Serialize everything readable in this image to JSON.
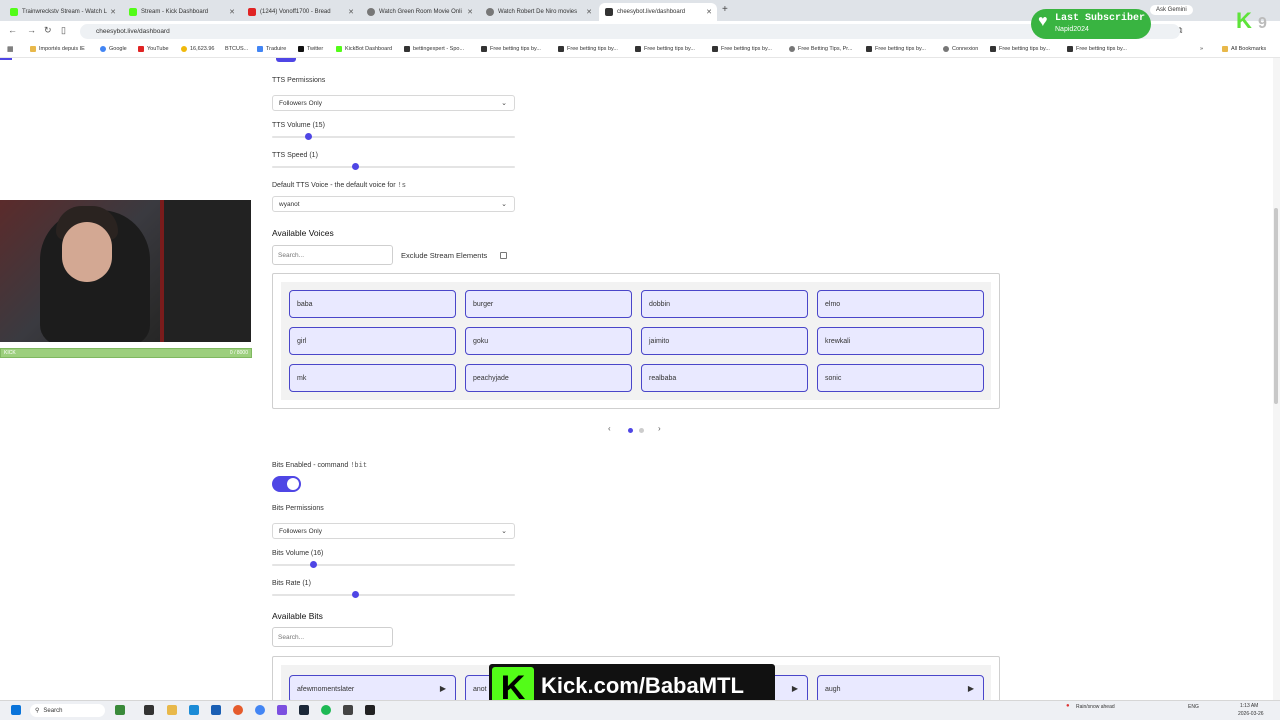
{
  "browser": {
    "tabs": [
      {
        "title": "Trainwreckstv Stream - Watch L"
      },
      {
        "title": "Stream - Kick Dashboard"
      },
      {
        "title": "(1244) Vonoff1700 - Bread"
      },
      {
        "title": "Watch Green Room Movie Onli"
      },
      {
        "title": "Watch Robert De Niro movies"
      },
      {
        "title": "cheesybot.live/dashboard"
      }
    ],
    "url": "cheesybot.live/dashboard",
    "ask_gemini": "Ask Gemini",
    "bookmarks": [
      "Importés depuis IE",
      "Google",
      "YouTube",
      "16,623.96",
      "BTCUS...",
      "Traduire",
      "Twitter",
      "KickBot Dashboard",
      "bettingexpert - Spo...",
      "Free betting tips by...",
      "Free betting tips by...",
      "Free betting tips by...",
      "Free betting tips by...",
      "Free Betting Tips, Pr...",
      "Free betting tips by...",
      "Connexion",
      "Free betting tips by...",
      "Free betting tips by..."
    ],
    "all_bookmarks": "All Bookmarks"
  },
  "tts": {
    "permissions_label": "TTS Permissions",
    "permissions_value": "Followers Only",
    "volume_label": "TTS Volume (15)",
    "volume_fraction": 0.15,
    "speed_label": "TTS Speed (1)",
    "speed_fraction": 0.34,
    "voice_label": "Default TTS Voice - the default voice for",
    "voice_cmd": "!s",
    "voice_value": "wyanot"
  },
  "voices": {
    "heading": "Available Voices",
    "search_placeholder": "Search...",
    "exclude_label": "Exclude Stream Elements",
    "items": [
      "baba",
      "burger",
      "dobbin",
      "elmo",
      "girl",
      "goku",
      "jaimito",
      "krewkali",
      "mk",
      "peachyjade",
      "realbaba",
      "sonic"
    ]
  },
  "bits": {
    "enabled_label": "Bits Enabled - command",
    "enabled_cmd": "!bit",
    "enabled": true,
    "permissions_label": "Bits Permissions",
    "permissions_value": "Followers Only",
    "volume_label": "Bits Volume (16)",
    "volume_fraction": 0.17,
    "rate_label": "Bits Rate (1)",
    "rate_fraction": 0.34,
    "heading": "Available Bits",
    "search_placeholder": "Search...",
    "items": [
      "afewmomentslater",
      "anot",
      "",
      "augh"
    ]
  },
  "overlay": {
    "last_sub_title": "Last Subscriber",
    "last_sub_name": "Napid2024",
    "kick_url": "Kick.com/BabaMTL",
    "kick_count": "9",
    "progress_left": "KICK",
    "progress_right": "0 / 8000"
  },
  "taskbar": {
    "search": "Search",
    "weather": "Rain/snow ahead",
    "lang": "ENG",
    "time": "1:13 AM",
    "date": "2026-03-26"
  }
}
